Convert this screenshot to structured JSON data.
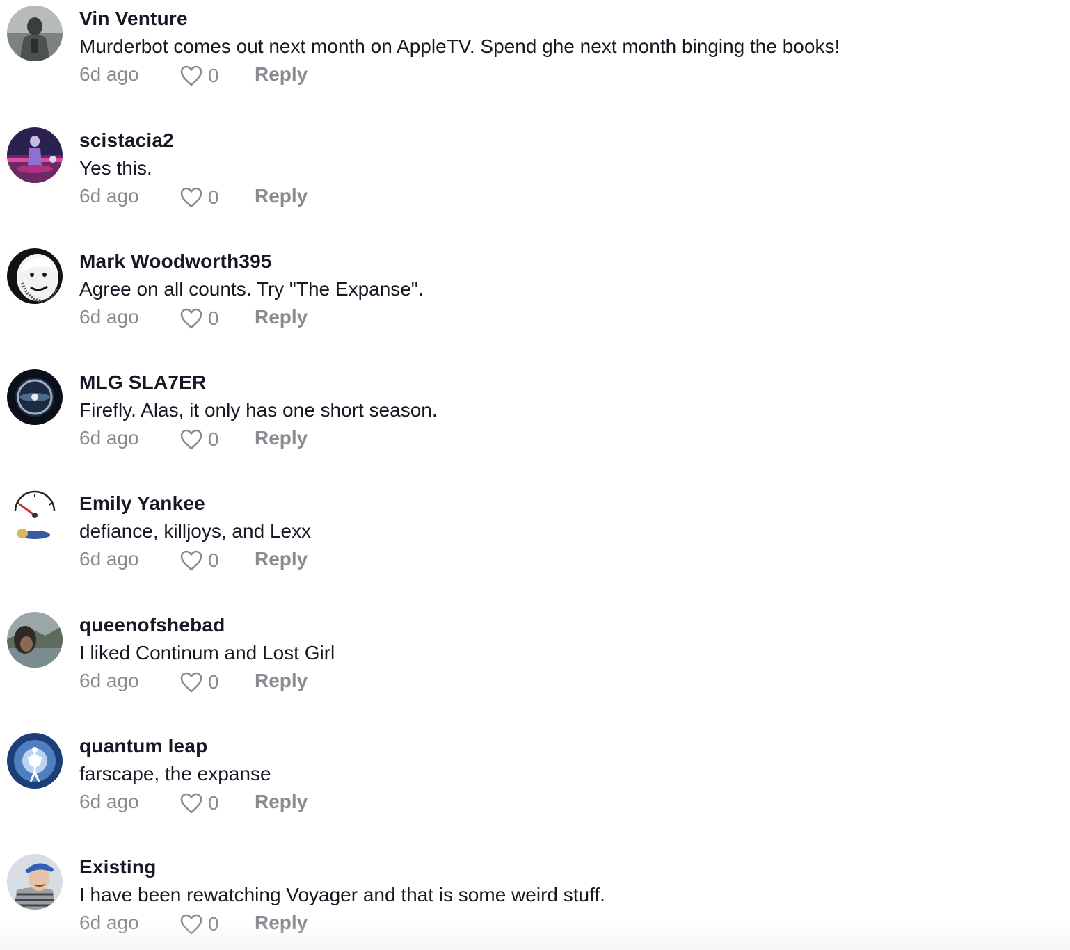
{
  "comments": [
    {
      "username": "Vin Venture",
      "text": "Murderbot comes out next month on AppleTV. Spend ghe next month binging the books!",
      "time": "6d ago",
      "likes": "0",
      "reply_label": "Reply",
      "avatar_icon": "robot-avatar"
    },
    {
      "username": "scistacia2",
      "text": "Yes this.",
      "time": "6d ago",
      "likes": "0",
      "reply_label": "Reply",
      "avatar_icon": "neon-figure-avatar"
    },
    {
      "username": "Mark Woodworth395",
      "text": "Agree on all counts. Try \"The Expanse\".",
      "time": "6d ago",
      "likes": "0",
      "reply_label": "Reply",
      "avatar_icon": "bw-face-avatar"
    },
    {
      "username": "MLG SLA7ER",
      "text": "Firefly. Alas, it only has one short season.",
      "time": "6d ago",
      "likes": "0",
      "reply_label": "Reply",
      "avatar_icon": "space-orb-avatar"
    },
    {
      "username": "Emily Yankee",
      "text": "defiance, killjoys, and Lexx",
      "time": "6d ago",
      "likes": "0",
      "reply_label": "Reply",
      "avatar_icon": "fuel-gauge-avatar"
    },
    {
      "username": "queenofshebad",
      "text": "I liked Continum and Lost Girl",
      "time": "6d ago",
      "likes": "0",
      "reply_label": "Reply",
      "avatar_icon": "landscape-avatar"
    },
    {
      "username": "quantum leap",
      "text": "farscape, the expanse",
      "time": "6d ago",
      "likes": "0",
      "reply_label": "Reply",
      "avatar_icon": "light-figure-avatar"
    },
    {
      "username": "Existing",
      "text": "I have been rewatching Voyager and that is some weird stuff.",
      "time": "6d ago",
      "likes": "0",
      "reply_label": "Reply",
      "avatar_icon": "person-cap-avatar"
    }
  ],
  "colors": {
    "text": "#161823",
    "secondary": "#8a8b91"
  }
}
